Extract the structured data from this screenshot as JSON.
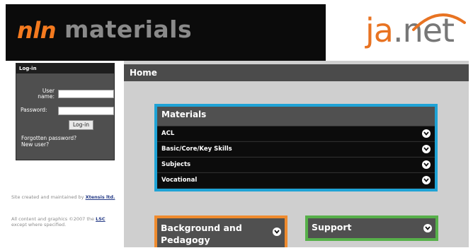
{
  "header": {
    "logo_prefix": "nln",
    "logo_suffix": "materials",
    "partner_logo_ja": "ja",
    "partner_logo_net": ".net"
  },
  "login": {
    "title": "Log-in",
    "user_label": "User name:",
    "password_label": "Password:",
    "button_label": "Log-in",
    "forgot_link": "Forgotten password?",
    "new_user_link": "New user?"
  },
  "footer": {
    "credit_text": "Site created and maintained by",
    "credit_link": "Xtensis ltd.",
    "copyright_text": "All content and graphics ©2007 the",
    "copyright_link": "LSC",
    "copyright_suffix": "except where specified."
  },
  "main": {
    "home_title": "Home",
    "materials": {
      "title": "Materials",
      "items": [
        {
          "label": "ACL"
        },
        {
          "label": "Basic/Core/Key Skills"
        },
        {
          "label": "Subjects"
        },
        {
          "label": "Vocational"
        }
      ]
    },
    "background": {
      "title": "Background and Pedagogy"
    },
    "support": {
      "title": "Support"
    }
  },
  "colors": {
    "materials_border": "#1fa3d6",
    "background_border": "#ef8b2e",
    "support_border": "#57b04a",
    "brand_orange": "#f47a1f"
  },
  "icons": {
    "expand": "chevron-down-icon"
  }
}
